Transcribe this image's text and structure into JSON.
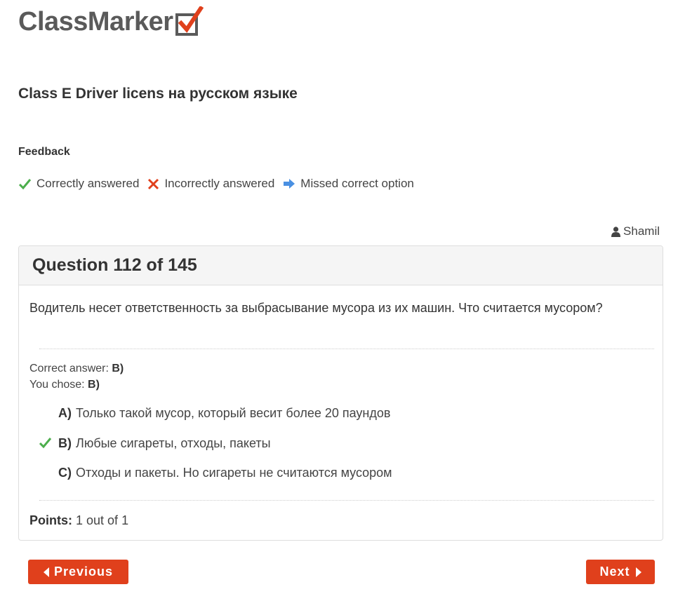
{
  "brand": {
    "logo_text": "ClassMarker",
    "logo_icon": "checkbox-check-icon",
    "logo_text_color": "#5a5a5a",
    "accent_color": "#e0401c"
  },
  "exam": {
    "title": "Class E Driver licens на русском языке"
  },
  "feedback": {
    "heading": "Feedback",
    "legend": {
      "correct": "Correctly answered",
      "incorrect": "Incorrectly answered",
      "missed": "Missed correct option"
    },
    "colors": {
      "correct": "#4cae4c",
      "incorrect": "#e0401c",
      "missed": "#4a90e2"
    }
  },
  "user": {
    "name": "Shamil",
    "icon": "user-icon"
  },
  "question": {
    "header": "Question 112 of 145",
    "text": "Водитель несет ответственность за выбрасывание мусора из их машин. Что считается мусором?",
    "correct_answer_label": "Correct answer:",
    "correct_answer_value": "B)",
    "you_chose_label": "You chose:",
    "you_chose_value": "B)",
    "options": [
      {
        "letter": "A)",
        "text": "Только такой мусор, который весит более 20 паундов",
        "marked_correct": false
      },
      {
        "letter": "B)",
        "text": "Любые сигареты, отходы, пакеты",
        "marked_correct": true
      },
      {
        "letter": "C)",
        "text": "Отходы и пакеты. Но сигареты не считаются мусором",
        "marked_correct": false
      }
    ],
    "points_label": "Points:",
    "points_value": "1 out of 1"
  },
  "nav": {
    "previous_label": "Previous",
    "next_label": "Next"
  }
}
